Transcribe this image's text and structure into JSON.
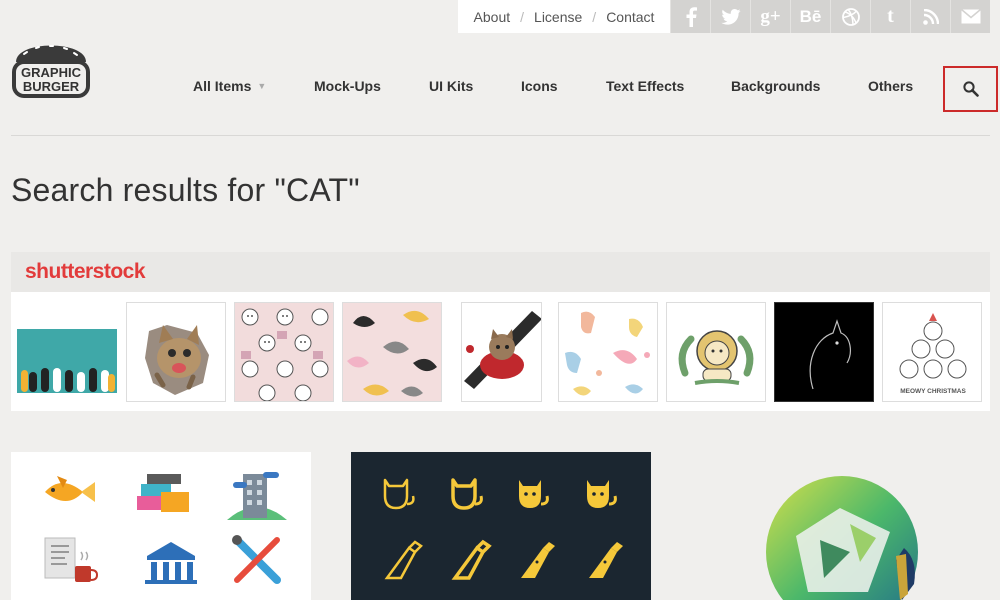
{
  "top_links": {
    "about": "About",
    "license": "License",
    "contact": "Contact",
    "separator": "/"
  },
  "social": [
    {
      "name": "facebook-icon",
      "glyph": "f"
    },
    {
      "name": "twitter-icon",
      "glyph": "t"
    },
    {
      "name": "google-plus-icon",
      "glyph": "g+"
    },
    {
      "name": "behance-icon",
      "glyph": "Bē"
    },
    {
      "name": "dribbble-icon",
      "glyph": "◎"
    },
    {
      "name": "tumblr-icon",
      "glyph": "t"
    },
    {
      "name": "rss-icon",
      "glyph": "rss"
    },
    {
      "name": "mail-icon",
      "glyph": "✉"
    }
  ],
  "logo": {
    "line1": "GRAPHIC",
    "line2": "BURGER"
  },
  "nav": {
    "all_items": "All Items",
    "mockups": "Mock-Ups",
    "ui_kits": "UI Kits",
    "icons": "Icons",
    "text_effects": "Text Effects",
    "backgrounds": "Backgrounds",
    "others": "Others"
  },
  "page_title": "Search results for \"CAT\"",
  "shutterstock": {
    "logo_text": "shutterstock",
    "thumbnails": [
      {
        "name": "cat-paws-teal"
      },
      {
        "name": "kitten-tearing-paper"
      },
      {
        "name": "cat-faces-pattern-pink"
      },
      {
        "name": "cats-pattern-black-white"
      },
      {
        "name": "super-cat-badge"
      },
      {
        "name": "pastel-cats-pattern"
      },
      {
        "name": "lion-cat-illustration"
      },
      {
        "name": "black-cat-silhouette"
      },
      {
        "name": "meowy-christmas-cats"
      }
    ],
    "meowy_text": "MEOWY CHRISTMAS"
  },
  "colors": {
    "accent_red": "#cc2a2a",
    "brand_red": "#e23b3b",
    "icon_yellow": "#f5c83a",
    "dark_card": "#1b2630"
  }
}
